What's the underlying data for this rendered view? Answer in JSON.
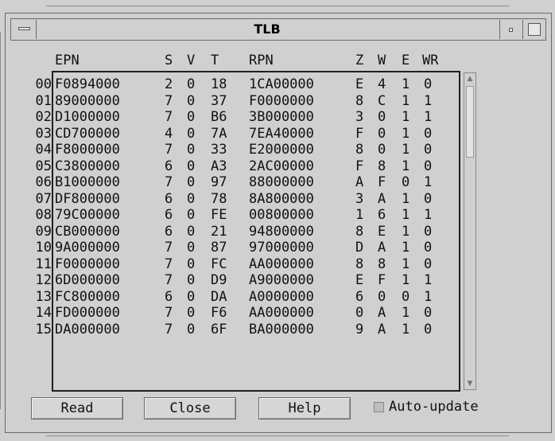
{
  "window": {
    "title": "TLB"
  },
  "headers": [
    "EPN",
    "S",
    "V",
    "T",
    "RPN",
    "Z",
    "W",
    "E",
    "WR"
  ],
  "rows": [
    {
      "num": "00",
      "epn": "F0894000",
      "s": "2",
      "v": "0",
      "t": "18",
      "rpn": "1CA00000",
      "z": "E",
      "w": "4",
      "e": "1",
      "wr": "0"
    },
    {
      "num": "01",
      "epn": "89000000",
      "s": "7",
      "v": "0",
      "t": "37",
      "rpn": "F0000000",
      "z": "8",
      "w": "C",
      "e": "1",
      "wr": "1"
    },
    {
      "num": "02",
      "epn": "D1000000",
      "s": "7",
      "v": "0",
      "t": "B6",
      "rpn": "3B000000",
      "z": "3",
      "w": "0",
      "e": "1",
      "wr": "1"
    },
    {
      "num": "03",
      "epn": "CD700000",
      "s": "4",
      "v": "0",
      "t": "7A",
      "rpn": "7EA40000",
      "z": "F",
      "w": "0",
      "e": "1",
      "wr": "0"
    },
    {
      "num": "04",
      "epn": "F8000000",
      "s": "7",
      "v": "0",
      "t": "33",
      "rpn": "E2000000",
      "z": "8",
      "w": "0",
      "e": "1",
      "wr": "0"
    },
    {
      "num": "05",
      "epn": "C3800000",
      "s": "6",
      "v": "0",
      "t": "A3",
      "rpn": "2AC00000",
      "z": "F",
      "w": "8",
      "e": "1",
      "wr": "0"
    },
    {
      "num": "06",
      "epn": "B1000000",
      "s": "7",
      "v": "0",
      "t": "97",
      "rpn": "88000000",
      "z": "A",
      "w": "F",
      "e": "0",
      "wr": "1"
    },
    {
      "num": "07",
      "epn": "DF800000",
      "s": "6",
      "v": "0",
      "t": "78",
      "rpn": "8A800000",
      "z": "3",
      "w": "A",
      "e": "1",
      "wr": "0"
    },
    {
      "num": "08",
      "epn": "79C00000",
      "s": "6",
      "v": "0",
      "t": "FE",
      "rpn": "00800000",
      "z": "1",
      "w": "6",
      "e": "1",
      "wr": "1"
    },
    {
      "num": "09",
      "epn": "CB000000",
      "s": "6",
      "v": "0",
      "t": "21",
      "rpn": "94800000",
      "z": "8",
      "w": "E",
      "e": "1",
      "wr": "0"
    },
    {
      "num": "10",
      "epn": "9A000000",
      "s": "7",
      "v": "0",
      "t": "87",
      "rpn": "97000000",
      "z": "D",
      "w": "A",
      "e": "1",
      "wr": "0"
    },
    {
      "num": "11",
      "epn": "F0000000",
      "s": "7",
      "v": "0",
      "t": "FC",
      "rpn": "AA000000",
      "z": "8",
      "w": "8",
      "e": "1",
      "wr": "0"
    },
    {
      "num": "12",
      "epn": "6D000000",
      "s": "7",
      "v": "0",
      "t": "D9",
      "rpn": "A9000000",
      "z": "E",
      "w": "F",
      "e": "1",
      "wr": "1"
    },
    {
      "num": "13",
      "epn": "FC800000",
      "s": "6",
      "v": "0",
      "t": "DA",
      "rpn": "A0000000",
      "z": "6",
      "w": "0",
      "e": "0",
      "wr": "1"
    },
    {
      "num": "14",
      "epn": "FD000000",
      "s": "7",
      "v": "0",
      "t": "F6",
      "rpn": "AA000000",
      "z": "0",
      "w": "A",
      "e": "1",
      "wr": "0"
    },
    {
      "num": "15",
      "epn": "DA000000",
      "s": "7",
      "v": "0",
      "t": "6F",
      "rpn": "BA000000",
      "z": "9",
      "w": "A",
      "e": "1",
      "wr": "0"
    }
  ],
  "buttons": {
    "read": "Read",
    "close": "Close",
    "help": "Help"
  },
  "auto_update": {
    "label": "Auto-update",
    "checked": false
  }
}
